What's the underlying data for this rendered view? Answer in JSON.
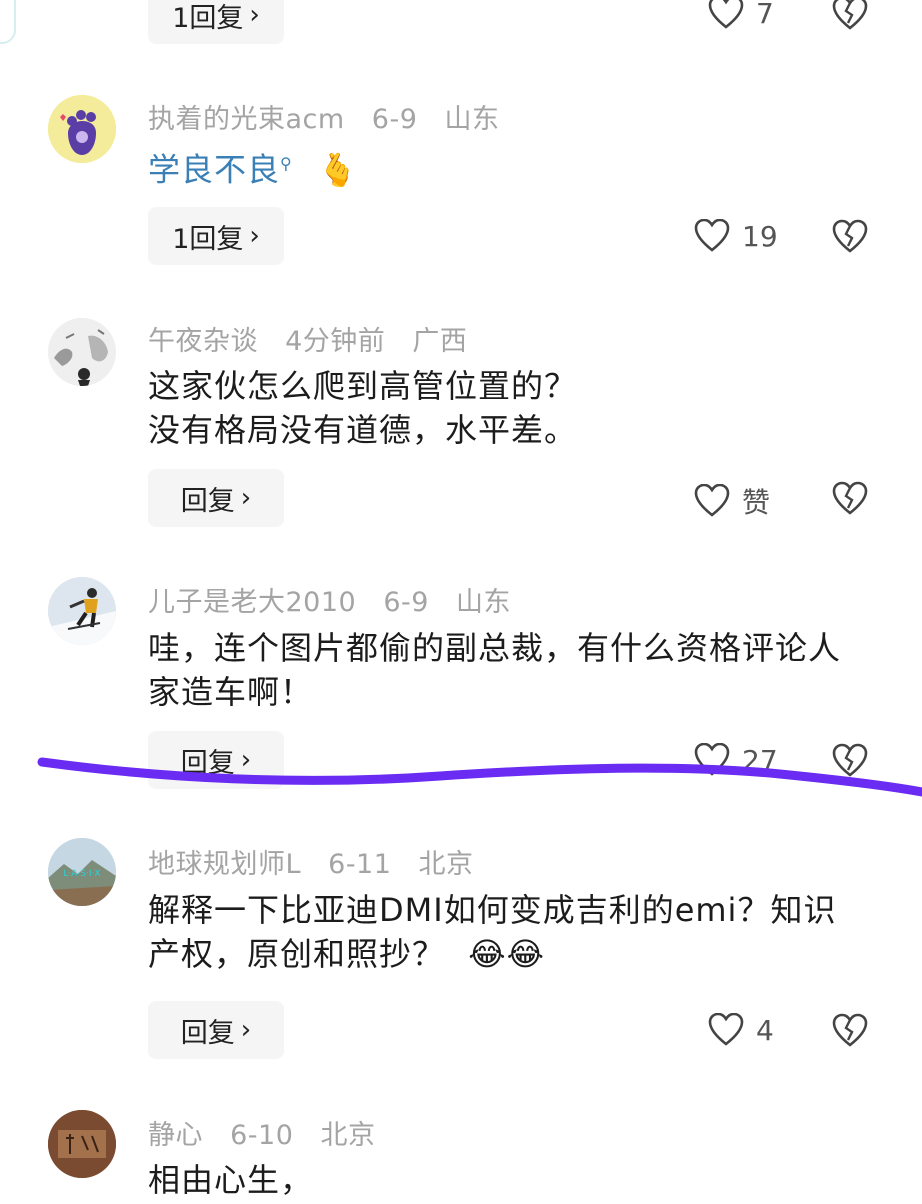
{
  "colors": {
    "meta_gray": "#a4a4a4",
    "topic_blue": "#3a7fb5",
    "reply_bg": "#f5f5f5",
    "annotation_purple": "#6a2bf2"
  },
  "top_partial": {
    "reply_label": "1回复",
    "like_count": "7"
  },
  "comments": [
    {
      "username": "执着的光束acm",
      "date": "6-9",
      "location": "山东",
      "topic": "学良不良",
      "emoji": "🫰",
      "reply_label": "1回复",
      "like_count": "19"
    },
    {
      "username": "午夜杂谈",
      "date": "4分钟前",
      "location": "广西",
      "line1": "这家伙怎么爬到高管位置的？",
      "line2": "没有格局没有道德，水平差。",
      "reply_label": "回复",
      "like_count": "赞"
    },
    {
      "username": "儿子是老大2010",
      "date": "6-9",
      "location": "山东",
      "line1": "哇，连个图片都偷的副总裁，有什么资格评论人",
      "line2": "家造车啊！",
      "reply_label": "回复",
      "like_count": "27"
    },
    {
      "username": "地球规划师L",
      "date": "6-11",
      "location": "北京",
      "line1": "解释一下比亚迪DMI如何变成吉利的emi？知识",
      "line2": "产权，原创和照抄？",
      "emoji": "😂😂",
      "reply_label": "回复",
      "like_count": "4"
    },
    {
      "username": "静心",
      "date": "6-10",
      "location": "北京",
      "line1": "相由心生，"
    }
  ],
  "avatar4_text": "L·A·S·I·X",
  "reply_chevron": "›"
}
